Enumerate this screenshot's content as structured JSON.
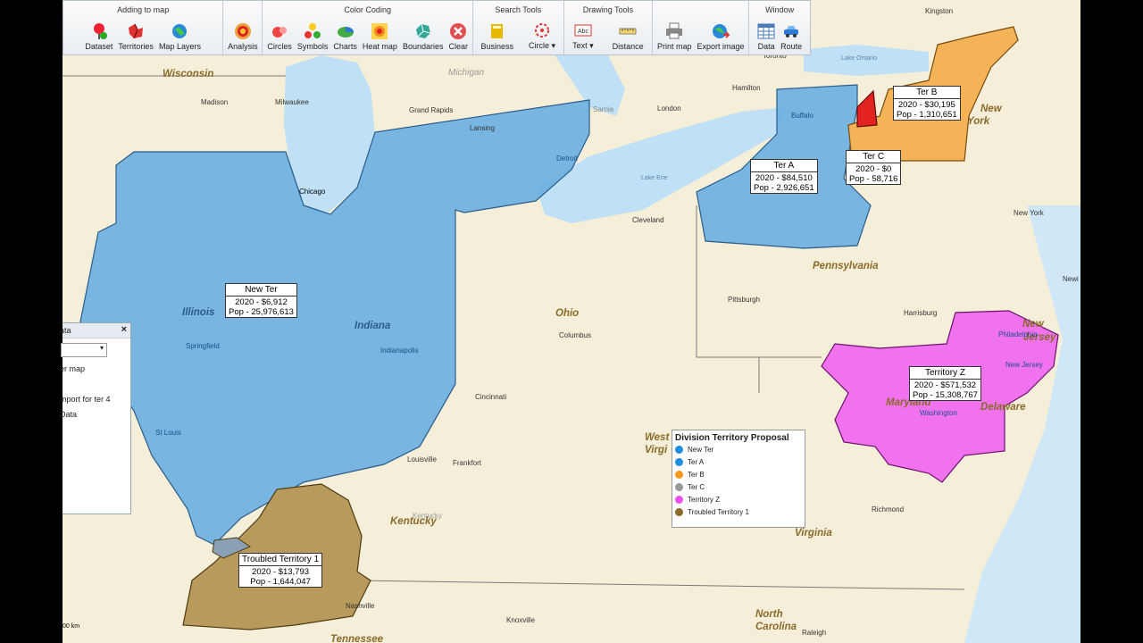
{
  "ribbon": {
    "groups": [
      {
        "title": "Adding to map",
        "tools": [
          {
            "label": "Dataset",
            "icon": "pin-plus-icon"
          },
          {
            "label": "Territories",
            "icon": "territories-icon"
          },
          {
            "label": "Map Layers",
            "icon": "globe-layers-icon"
          }
        ]
      },
      {
        "title": "",
        "tools": [
          {
            "label": "Analysis",
            "icon": "analysis-target-icon"
          }
        ]
      },
      {
        "title": "Color Coding",
        "tools": [
          {
            "label": "Circles",
            "icon": "circles-icon"
          },
          {
            "label": "Symbols",
            "icon": "symbols-icon"
          },
          {
            "label": "Charts",
            "icon": "charts-icon"
          },
          {
            "label": "Heat map",
            "icon": "heatmap-icon"
          },
          {
            "label": "Boundaries",
            "icon": "boundaries-icon"
          },
          {
            "label": "Clear",
            "icon": "clear-x-icon"
          }
        ]
      },
      {
        "title": "Search Tools",
        "tools": [
          {
            "label": "Business",
            "icon": "business-book-icon"
          },
          {
            "label": "Circle ▾",
            "icon": "circle-search-icon"
          }
        ]
      },
      {
        "title": "Drawing Tools",
        "tools": [
          {
            "label": "Text ▾",
            "icon": "text-box-icon"
          },
          {
            "label": "Distance",
            "icon": "ruler-icon"
          }
        ]
      },
      {
        "title": "",
        "tools": [
          {
            "label": "Print map",
            "icon": "printer-icon"
          },
          {
            "label": "Export image",
            "icon": "export-globe-icon"
          }
        ]
      },
      {
        "title": "Window",
        "tools": [
          {
            "label": "Data",
            "icon": "data-grid-icon"
          },
          {
            "label": "Route",
            "icon": "route-car-icon"
          }
        ]
      }
    ]
  },
  "sidepanel": {
    "title": "ata",
    "close": "×",
    "lines": [
      "er map",
      "mport for ter 4",
      "Data"
    ]
  },
  "territories": [
    {
      "name": "New Ter",
      "line1": "2020 -  $6,912",
      "line2": "Pop - 25,976,613",
      "color": "#6aaee0"
    },
    {
      "name": "Ter A",
      "line1": "2020 -  $84,510",
      "line2": "Pop - 2,926,651",
      "color": "#6aaee0"
    },
    {
      "name": "Ter B",
      "line1": "2020 -  $30,195",
      "line2": "Pop - 1,310,651",
      "color": "#f4b356"
    },
    {
      "name": "Ter C",
      "line1": "2020 -  $0",
      "line2": "Pop - 58,716",
      "color": "#e32222"
    },
    {
      "name": "Territory Z",
      "line1": "2020 -  $571,532",
      "line2": "Pop - 15,308,767",
      "color": "#f06af0"
    },
    {
      "name": "Troubled Territory 1",
      "line1": "2020 -  $13,793",
      "line2": "Pop - 1,644,047",
      "color": "#b89a5c"
    }
  ],
  "legend": {
    "title": "Division Territory Proposal",
    "items": [
      {
        "label": "New Ter",
        "color": "#1e8fe0"
      },
      {
        "label": "Ter A",
        "color": "#1e8fe0"
      },
      {
        "label": "Ter B",
        "color": "#f39a1e"
      },
      {
        "label": "Ter C",
        "color": "#999999"
      },
      {
        "label": "Territory Z",
        "color": "#f050f0"
      },
      {
        "label": "Troubled Territory 1",
        "color": "#8c6a2a"
      }
    ]
  },
  "states": [
    "Wisconsin",
    "Michigan",
    "Illinois",
    "Indiana",
    "Ohio",
    "Pennsylvania",
    "New",
    "York",
    "Kentucky",
    "Virginia",
    "West",
    "Virgi",
    "Maryland",
    "Delaware",
    "New",
    "Jersey",
    "North",
    "Carolina",
    "Tennessee"
  ],
  "cities": [
    "Madison",
    "Milwaukee",
    "Grand Rapids",
    "Lansing",
    "Detroit",
    "Chicago",
    "Toronto",
    "Hamilton",
    "London",
    "Sarnia",
    "Buffalo",
    "Kingston",
    "Cleveland",
    "Pittsburgh",
    "Harrisburg",
    "Philadelphia",
    "New Jersey",
    "Washington",
    "Columbus",
    "Cincinnati",
    "Indianapolis",
    "Springfield",
    "St Louis",
    "Louisville",
    "Frankfort",
    "Kentucky",
    "Richmond",
    "Knoxville",
    "Raleigh",
    "Nashville",
    "Lake Ontario",
    "Lake Erie",
    "New York",
    "Newi"
  ],
  "scale": "00 km"
}
